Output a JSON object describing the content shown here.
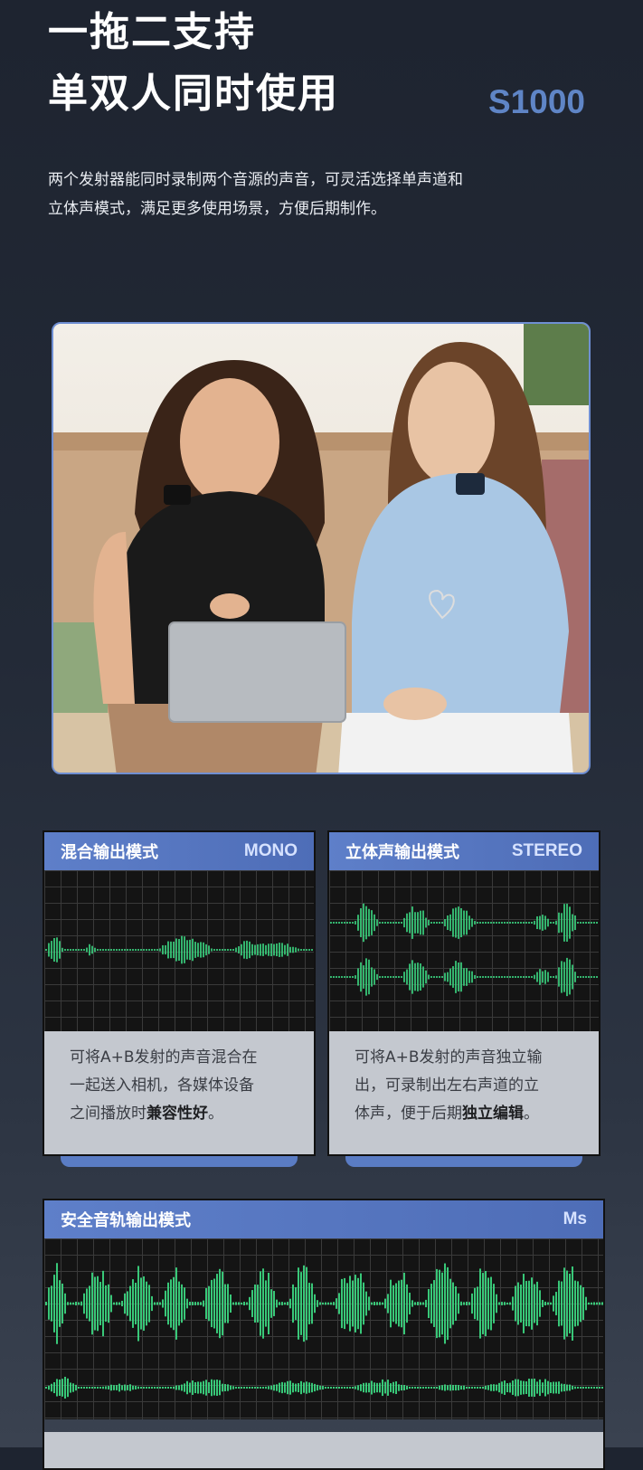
{
  "header": {
    "title_line1": "一拖二支持",
    "title_line2": "单双人同时使用",
    "model": "S1000",
    "description_line1": "两个发射器能同时录制两个音源的声音，可灵活选择单声道和",
    "description_line2": "立体声模式，满足更多使用场景，方便后期制作。"
  },
  "cards": [
    {
      "title": "混合输出模式",
      "badge": "MONO",
      "text_line1": "可将A+B发射的声音混合在",
      "text_line2": "一起送入相机，各媒体设备",
      "text_line3_prefix": "之间播放时",
      "text_line3_bold": "兼容性好",
      "text_line3_suffix": "。"
    },
    {
      "title": "立体声输出模式",
      "badge": "STEREO",
      "text_line1": "可将A+B发射的声音独立输",
      "text_line2": "出，可录制出左右声道的立",
      "text_line3_prefix": "体声，便于后期",
      "text_line3_bold": "独立编辑",
      "text_line3_suffix": "。"
    },
    {
      "title": "安全音轨输出模式",
      "badge": "Ms"
    }
  ],
  "colors": {
    "accent": "#5f85c6",
    "waveform": "#3ddc84",
    "header_blue": "#5e7fc9",
    "background": "#232a37"
  }
}
